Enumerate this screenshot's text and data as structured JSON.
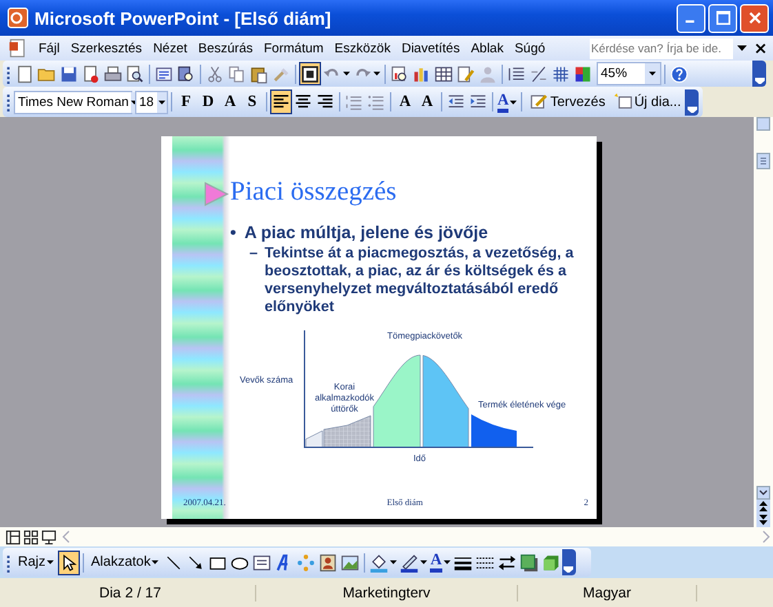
{
  "window": {
    "title": "Microsoft PowerPoint - [Első diám]"
  },
  "menu": {
    "items": [
      {
        "label": "Fájl"
      },
      {
        "label": "Szerkesztés"
      },
      {
        "label": "Nézet"
      },
      {
        "label": "Beszúrás"
      },
      {
        "label": "Formátum"
      },
      {
        "label": "Eszközök"
      },
      {
        "label": "Diavetítés"
      },
      {
        "label": "Ablak"
      },
      {
        "label": "Súgó"
      }
    ],
    "help_box": {
      "placeholder": "Kérdése van? Írja be ide."
    },
    "close": "×"
  },
  "standard_toolbar": {
    "items": [
      {
        "kind": "icon",
        "pressed": false
      },
      {
        "kind": "icon",
        "pressed": false
      },
      {
        "kind": "icon",
        "pressed": false
      },
      {
        "kind": "icon",
        "pressed": false
      },
      {
        "kind": "icon",
        "pressed": false
      },
      {
        "kind": "icon",
        "pressed": false
      },
      {
        "kind": "separator"
      },
      {
        "kind": "icon",
        "pressed": false
      },
      {
        "kind": "icon",
        "pressed": false
      },
      {
        "kind": "separator"
      },
      {
        "kind": "icon",
        "pressed": false
      },
      {
        "kind": "icon",
        "pressed": false
      },
      {
        "kind": "icon",
        "pressed": false
      },
      {
        "kind": "icon",
        "pressed": false
      },
      {
        "kind": "separator"
      },
      {
        "kind": "icon",
        "pressed": true
      },
      {
        "kind": "icon-dropdown",
        "pressed": false
      },
      {
        "kind": "icon-dropdown",
        "pressed": false
      },
      {
        "kind": "separator"
      },
      {
        "kind": "icon",
        "pressed": false
      },
      {
        "kind": "icon",
        "pressed": false
      },
      {
        "kind": "icon",
        "pressed": false
      },
      {
        "kind": "icon",
        "pressed": false
      },
      {
        "kind": "icon",
        "pressed": false
      },
      {
        "kind": "separator"
      },
      {
        "kind": "icon",
        "pressed": false
      },
      {
        "kind": "icon",
        "pressed": false
      },
      {
        "kind": "icon",
        "pressed": false
      },
      {
        "kind": "icon",
        "pressed": false
      },
      {
        "kind": "combo",
        "value": "45%"
      },
      {
        "kind": "separator"
      },
      {
        "kind": "icon",
        "pressed": false
      }
    ]
  },
  "formatting_toolbar": {
    "items": [
      {
        "kind": "combo",
        "value": "Times New Roman"
      },
      {
        "kind": "combo",
        "value": "18"
      },
      {
        "kind": "separator"
      },
      {
        "kind": "letter",
        "label": "F",
        "pressed": false
      },
      {
        "kind": "letter",
        "label": "D",
        "pressed": false
      },
      {
        "kind": "letter",
        "label": "A",
        "pressed": false
      },
      {
        "kind": "letter",
        "label": "S",
        "pressed": false
      },
      {
        "kind": "separator"
      },
      {
        "kind": "icon",
        "pressed": true
      },
      {
        "kind": "icon",
        "pressed": false
      },
      {
        "kind": "icon",
        "pressed": false
      },
      {
        "kind": "separator"
      },
      {
        "kind": "icon",
        "pressed": false
      },
      {
        "kind": "icon",
        "pressed": false
      },
      {
        "kind": "separator"
      },
      {
        "kind": "letter",
        "label": "A",
        "pressed": false
      },
      {
        "kind": "letter",
        "label": "A",
        "pressed": false
      },
      {
        "kind": "separator"
      },
      {
        "kind": "icon",
        "pressed": false
      },
      {
        "kind": "icon",
        "pressed": false
      },
      {
        "kind": "separator"
      },
      {
        "kind": "letter-dropdown",
        "label": "A",
        "pressed": false
      },
      {
        "kind": "separator"
      },
      {
        "kind": "text-button",
        "label": "Tervezés",
        "pressed": false
      },
      {
        "kind": "text-button",
        "label": "Új dia...",
        "pressed": false
      }
    ]
  },
  "slide": {
    "title": "Piaci összegzés",
    "bullets": [
      {
        "marker": "•",
        "text": "A piac múltja, jelene és jövője",
        "children": [
          {
            "marker": "–",
            "text": "Tekintse át a piacmegosztás, a vezetőség, a beosztottak, a piac, az ár és költségek és a versenyhelyzet megváltoztatásából eredő előnyöket"
          }
        ]
      }
    ],
    "diagram": {
      "labels": [
        {
          "kind": "peak",
          "text": "Tömegpiackövetők"
        },
        {
          "kind": "y-axis",
          "text": "Vevők száma"
        },
        {
          "kind": "early",
          "text": "Korai alkalmazkodók úttörők"
        },
        {
          "kind": "late",
          "text": "Termék életének vége"
        },
        {
          "kind": "x-axis",
          "text": "Idő"
        }
      ]
    },
    "footer": {
      "date": "2007.04.21.",
      "title": "Első diám",
      "number": "2"
    }
  },
  "drawing_toolbar": {
    "items": [
      {
        "kind": "menu-button",
        "label": "Rajz"
      },
      {
        "kind": "icon",
        "pressed": true
      },
      {
        "kind": "separator"
      },
      {
        "kind": "menu-button",
        "label": "Alakzatok"
      },
      {
        "kind": "icon",
        "pressed": false
      },
      {
        "kind": "icon",
        "pressed": false
      },
      {
        "kind": "icon",
        "pressed": false
      },
      {
        "kind": "icon",
        "pressed": false
      },
      {
        "kind": "icon",
        "pressed": false
      },
      {
        "kind": "icon",
        "pressed": false
      },
      {
        "kind": "icon",
        "pressed": false
      },
      {
        "kind": "icon",
        "pressed": false
      },
      {
        "kind": "icon",
        "pressed": false
      },
      {
        "kind": "separator"
      },
      {
        "kind": "icon-dropdown",
        "pressed": false
      },
      {
        "kind": "icon-dropdown",
        "pressed": false
      },
      {
        "kind": "letter-dropdown",
        "label": "A",
        "pressed": false
      },
      {
        "kind": "icon",
        "pressed": false
      },
      {
        "kind": "icon",
        "pressed": false
      },
      {
        "kind": "icon",
        "pressed": false
      },
      {
        "kind": "icon",
        "pressed": false
      },
      {
        "kind": "icon",
        "pressed": false
      }
    ]
  },
  "status_bar": {
    "fields": [
      "Dia 2 / 17",
      "Marketingterv",
      "Magyar"
    ]
  }
}
